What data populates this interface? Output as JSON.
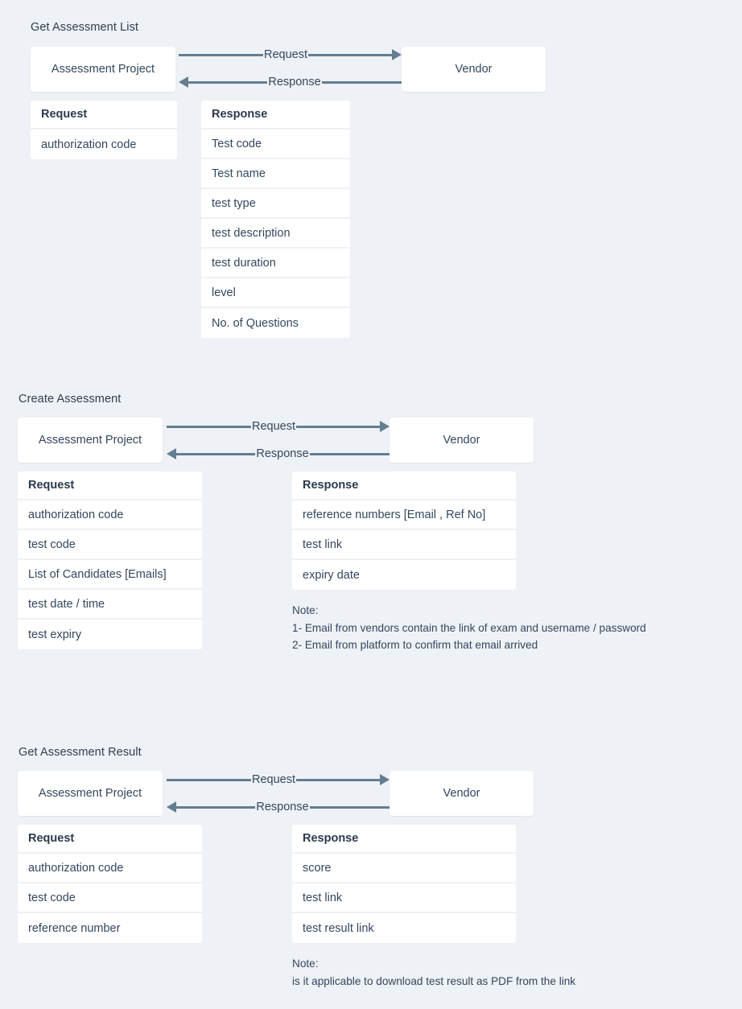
{
  "page": {
    "background_color": "#eef1f5",
    "card_color": "#ffffff",
    "text_color": "#33475e",
    "arrow_color": "#647d91"
  },
  "sections": [
    {
      "title": "Get Assessment List",
      "actor_left": "Assessment Project",
      "actor_right": "Vendor",
      "arrow_request_label": "Request",
      "arrow_response_label": "Response",
      "request_table": {
        "header": "Request",
        "rows": [
          "authorization code"
        ]
      },
      "response_table": {
        "header": "Response",
        "rows": [
          "Test code",
          "Test name",
          "test type",
          "test description",
          "test duration",
          "level",
          "No. of Questions"
        ]
      },
      "note": null
    },
    {
      "title": "Create Assessment",
      "actor_left": "Assessment Project",
      "actor_right": "Vendor",
      "arrow_request_label": "Request",
      "arrow_response_label": "Response",
      "request_table": {
        "header": "Request",
        "rows": [
          "authorization code",
          "test code",
          "List of Candidates [Emails]",
          "test date / time",
          "test expiry"
        ]
      },
      "response_table": {
        "header": "Response",
        "rows": [
          "reference numbers [Email , Ref No]",
          "test link",
          "expiry date"
        ]
      },
      "note": {
        "label": "Note:",
        "lines": [
          "1- Email from vendors contain the link of exam and username / password",
          "2- Email from platform to confirm that email arrived"
        ]
      }
    },
    {
      "title": "Get Assessment Result",
      "actor_left": "Assessment Project",
      "actor_right": "Vendor",
      "arrow_request_label": "Request",
      "arrow_response_label": "Response",
      "request_table": {
        "header": "Request",
        "rows": [
          "authorization code",
          "test code",
          "reference number"
        ]
      },
      "response_table": {
        "header": "Response",
        "rows": [
          "score",
          "test link",
          "test result link"
        ]
      },
      "note": {
        "label": "Note:",
        "lines": [
          "is it applicable to download test result as PDF from the link"
        ]
      }
    }
  ]
}
